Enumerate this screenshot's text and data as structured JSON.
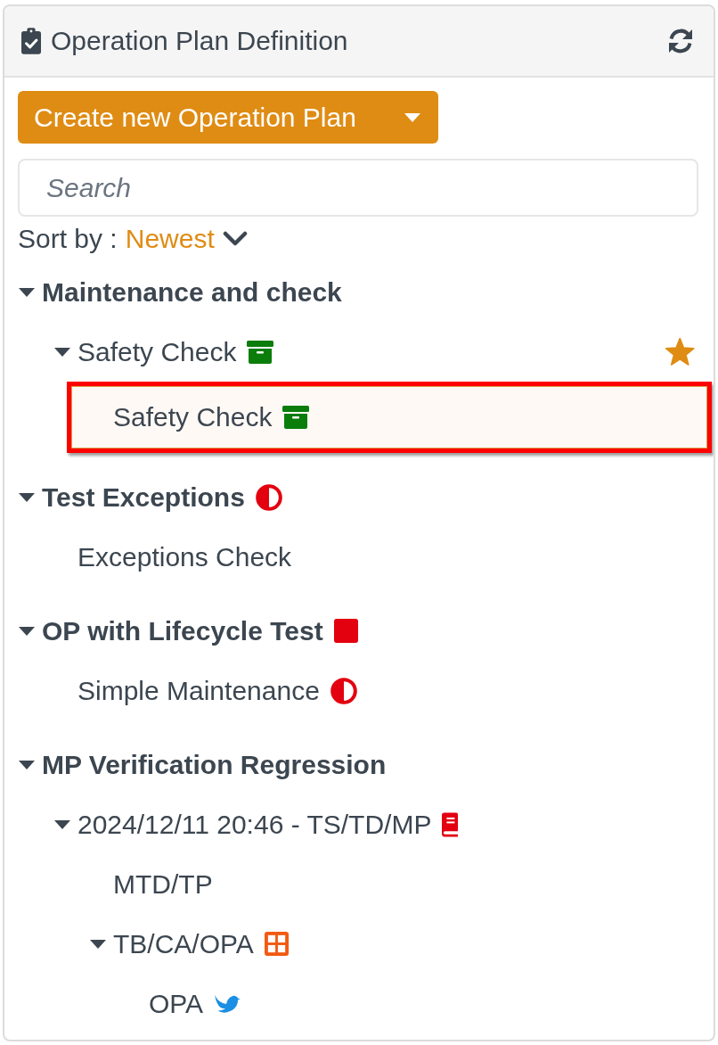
{
  "panel": {
    "title": "Operation Plan Definition"
  },
  "create_button": {
    "label": "Create new Operation Plan"
  },
  "search": {
    "placeholder": "Search"
  },
  "sort": {
    "label": "Sort by :",
    "value": "Newest"
  },
  "tree": [
    {
      "label": "Maintenance and check",
      "kind": "plain",
      "expanded": true,
      "starred": false,
      "selected": false,
      "children": [
        {
          "label": "Safety Check",
          "kind": "archive",
          "expanded": true,
          "starred": true,
          "selected": false,
          "children": [
            {
              "label": "Safety Check",
              "kind": "archive",
              "starred": false,
              "selected": true
            }
          ]
        }
      ]
    },
    {
      "label": "Test Exceptions",
      "kind": "half-circle",
      "expanded": true,
      "starred": false,
      "selected": false,
      "children": [
        {
          "label": "Exceptions Check",
          "kind": "plain",
          "starred": false,
          "selected": false
        }
      ]
    },
    {
      "label": "OP with Lifecycle Test",
      "kind": "square",
      "expanded": true,
      "starred": false,
      "selected": false,
      "children": [
        {
          "label": "Simple Maintenance",
          "kind": "half-circle",
          "starred": false,
          "selected": false
        }
      ]
    },
    {
      "label": "MP Verification Regression",
      "kind": "plain",
      "expanded": true,
      "starred": false,
      "selected": false,
      "children": [
        {
          "label": "2024/12/11 20:46 - TS/TD/MP",
          "kind": "book",
          "expanded": true,
          "starred": false,
          "selected": false,
          "children": [
            {
              "label": "MTD/TP",
              "kind": "plain",
              "starred": false,
              "selected": false
            },
            {
              "label": "TB/CA/OPA",
              "kind": "grid",
              "expanded": true,
              "starred": false,
              "selected": false,
              "children": [
                {
                  "label": "OPA",
                  "kind": "bird",
                  "starred": false,
                  "selected": false
                }
              ]
            }
          ]
        }
      ]
    }
  ]
}
